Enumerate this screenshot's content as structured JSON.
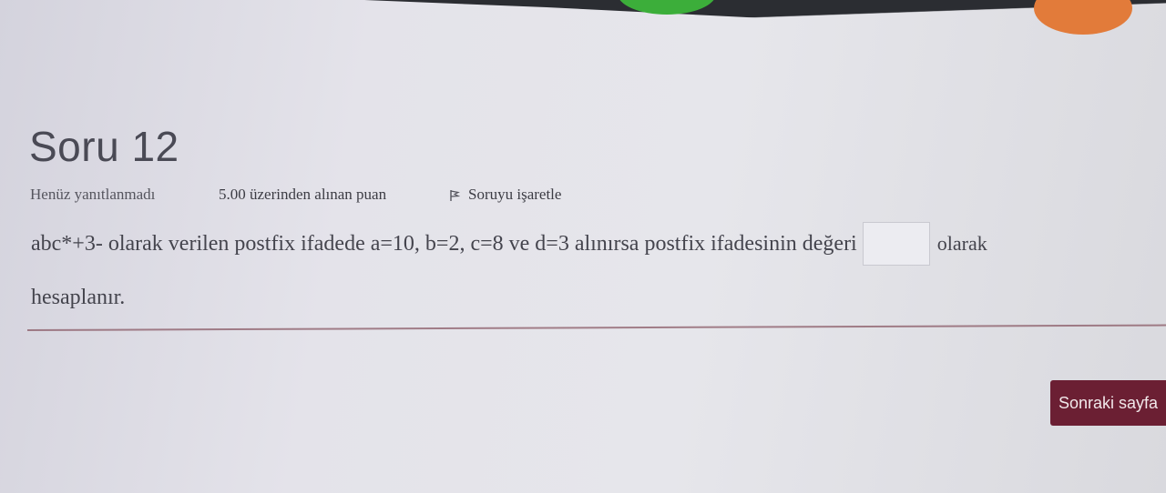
{
  "question": {
    "title": "Soru 12",
    "status": "Henüz yanıtlanmadı",
    "points": "5.00 üzerinden alınan puan",
    "flag_label": "Soruyu işaretle",
    "text_before": "abc*+3- olarak verilen postfix ifadede a=10, b=2, c=8 ve d=3 alınırsa postfix ifadesinin değeri",
    "answer_value": "",
    "text_after": "olarak",
    "text_line2": "hesaplanır."
  },
  "navigation": {
    "next_label": "Sonraki sayfa"
  },
  "colors": {
    "next_button": "#6b1f33",
    "divider": "#8a5a66",
    "text": "#44444d"
  },
  "icons": {
    "flag": "flag-icon"
  }
}
